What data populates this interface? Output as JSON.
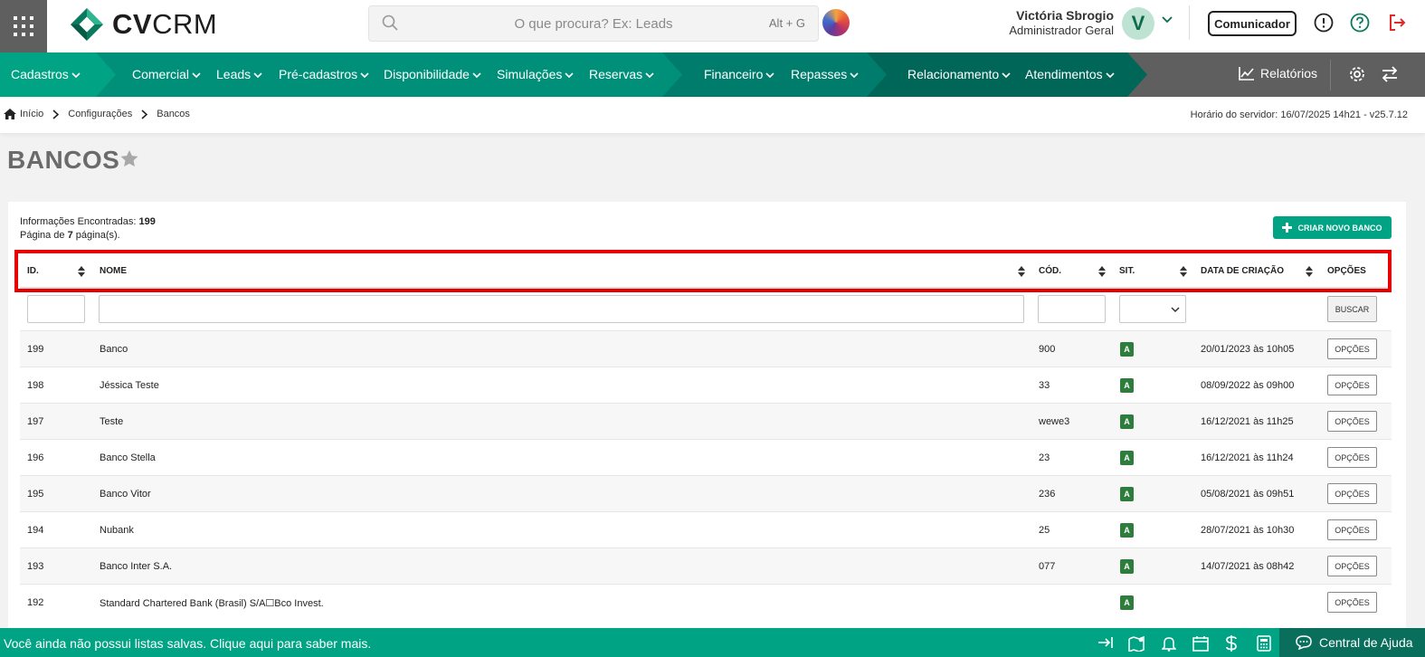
{
  "header": {
    "logo_text_bold": "CV",
    "logo_text_light": "CRM",
    "search_placeholder": "O que procura? Ex: Leads",
    "search_shortcut": "Alt + G",
    "user_name": "Victória Sbrogio",
    "user_role": "Administrador Geral",
    "avatar_letter": "V",
    "comunicador_label": "Comunicador"
  },
  "nav": {
    "items": [
      "Cadastros",
      "Comercial",
      "Leads",
      "Pré-cadastros",
      "Disponibilidade",
      "Simulações",
      "Reservas",
      "Financeiro",
      "Repasses",
      "Relacionamento",
      "Atendimentos"
    ],
    "relatorios": "Relatórios"
  },
  "breadcrumb": {
    "items": [
      "Início",
      "Configurações",
      "Bancos"
    ],
    "server_time": "Horário do servidor: 16/07/2025 14h21 - v25.7.12"
  },
  "page": {
    "title": "BANCOS",
    "found_label": "Informações Encontradas:",
    "found_count": "199",
    "page_label_pre": "Página de",
    "page_count": "7",
    "page_label_post": "página(s).",
    "create_button": "CRIAR NOVO BANCO"
  },
  "table": {
    "columns": [
      "ID.",
      "NOME",
      "CÓD.",
      "SIT.",
      "DATA DE CRIAÇÃO",
      "OPÇÕES"
    ],
    "search_button": "BUSCAR",
    "option_button": "OPÇÕES",
    "rows": [
      {
        "id": "199",
        "name": "Banco",
        "code": "900",
        "status": "A",
        "created": "20/01/2023 às 10h05"
      },
      {
        "id": "198",
        "name": "Jéssica Teste",
        "code": "33",
        "status": "A",
        "created": "08/09/2022 às 09h00"
      },
      {
        "id": "197",
        "name": "Teste",
        "code": "wewe3",
        "status": "A",
        "created": "16/12/2021 às 11h25"
      },
      {
        "id": "196",
        "name": "Banco Stella",
        "code": "23",
        "status": "A",
        "created": "16/12/2021 às 11h24"
      },
      {
        "id": "195",
        "name": "Banco Vitor",
        "code": "236",
        "status": "A",
        "created": "05/08/2021 às 09h51"
      },
      {
        "id": "194",
        "name": "Nubank",
        "code": "25",
        "status": "A",
        "created": "28/07/2021 às 10h30"
      },
      {
        "id": "193",
        "name": "Banco Inter S.A.",
        "code": "077",
        "status": "A",
        "created": "14/07/2021 às 08h42"
      },
      {
        "id": "192",
        "name": "Standard Chartered Bank (Brasil) S/A☐Bco Invest.",
        "code": "",
        "status": "A",
        "created": ""
      }
    ]
  },
  "footer": {
    "message": "Você ainda não possui listas salvas. Clique aqui para saber mais.",
    "help": "Central de Ajuda"
  },
  "colors": {
    "primary_green": "#00a383",
    "nav_gray": "#5f5f5f",
    "highlight_red": "#e60000",
    "status_green": "#2e7d3c"
  }
}
